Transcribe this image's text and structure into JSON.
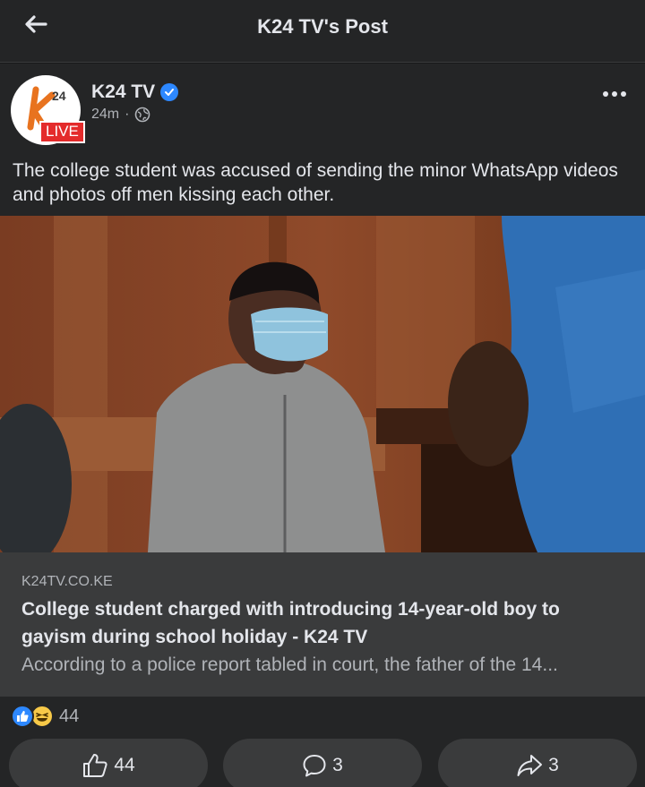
{
  "header": {
    "title": "K24 TV's Post"
  },
  "post": {
    "author": "K24 TV",
    "badge": "LIVE",
    "time": "24m",
    "dot": "·",
    "caption": "The college student was accused of sending the minor WhatsApp videos and photos off men kissing each other.",
    "logo_text": "24"
  },
  "link": {
    "domain": "K24TV.CO.KE",
    "title": "College student charged with introducing 14-year-old boy to gayism during school holiday - K24 TV",
    "description": "According to a police report tabled in court, the father of the 14..."
  },
  "reactions": {
    "count": "44",
    "types": [
      "like-icon",
      "haha-icon"
    ]
  },
  "actions": {
    "like_count": "44",
    "comment_count": "3",
    "share_count": "3"
  },
  "icons": {
    "back": "arrow-left-icon",
    "verified": "verified-icon",
    "globe": "globe-icon",
    "more": "more-options-icon",
    "like": "thumbs-up-icon",
    "comment": "comment-icon",
    "share": "share-icon"
  },
  "colors": {
    "accent": "#2d88ff",
    "live": "#e42b2b",
    "background": "#242526"
  }
}
